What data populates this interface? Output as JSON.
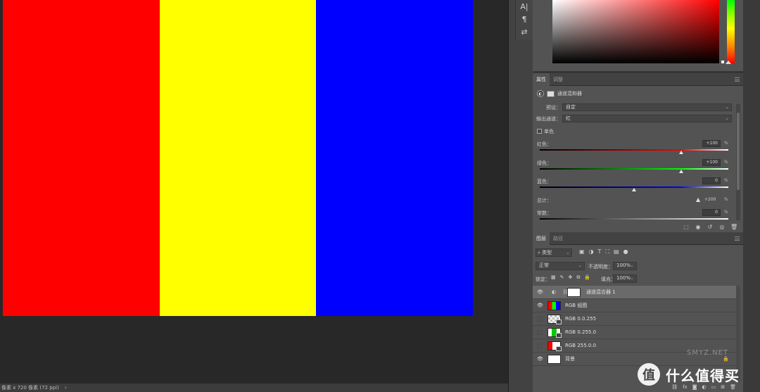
{
  "canvas": {
    "stripes": [
      {
        "name": "red",
        "color": "#ff0000"
      },
      {
        "name": "yellow",
        "color": "#ffff00"
      },
      {
        "name": "blue",
        "color": "#0000ff"
      }
    ]
  },
  "status_bar": {
    "text": "像素 x 720 像素 (72 ppi)",
    "arrow": "›"
  },
  "tool_strip": {
    "icons": [
      {
        "name": "character-icon",
        "glyph": "A|"
      },
      {
        "name": "paragraph-icon",
        "glyph": "¶"
      },
      {
        "name": "adjust-sliders-icon",
        "glyph": "⇄"
      }
    ]
  },
  "properties_panel": {
    "tabs": [
      "属性",
      "调整"
    ],
    "title": "通道混和器",
    "preset_label": "预设：",
    "preset_value": "自定",
    "output_label": "输出通道：",
    "output_value": "红",
    "mono_label": "单色",
    "red_label": "红色：",
    "red_value": "+100",
    "green_label": "绿色：",
    "green_value": "+100",
    "blue_label": "蓝色：",
    "blue_value": "0",
    "total_label": "总计：",
    "total_value": "+200",
    "constant_label": "常数：",
    "constant_value": "0",
    "percent": "%",
    "slider_levels": {
      "red": 0.75,
      "green": 0.75,
      "blue": 0.5,
      "constant": 0.5
    },
    "colors": {
      "red_track": "#ff0000",
      "green_track": "#00ff00",
      "blue_track": "#0000ff"
    }
  },
  "layers_panel": {
    "tabs": [
      "图层",
      "路径"
    ],
    "filter_label": "类型",
    "blend_mode": "正常",
    "opacity_label": "不透明度：",
    "opacity_value": "100%",
    "lock_label": "锁定：",
    "fill_label": "填充：",
    "fill_value": "100%",
    "layers": [
      {
        "name": "通道混合器 1",
        "visible": true,
        "selected": true,
        "thumb": "adjustment"
      },
      {
        "name": "RGB 组图",
        "visible": true,
        "selected": false,
        "thumb": "rgb"
      },
      {
        "name": "RGB 0.0.255",
        "visible": false,
        "selected": false,
        "thumb": "smart-blue"
      },
      {
        "name": "RGB 0.255.0",
        "visible": false,
        "selected": false,
        "thumb": "smart-green"
      },
      {
        "name": "RGB 255.0.0",
        "visible": false,
        "selected": false,
        "thumb": "smart-red"
      },
      {
        "name": "背景",
        "visible": true,
        "selected": false,
        "thumb": "white"
      }
    ]
  },
  "watermark": {
    "logo": "值",
    "text": "什么值得买",
    "url": "SMYZ.NET"
  }
}
